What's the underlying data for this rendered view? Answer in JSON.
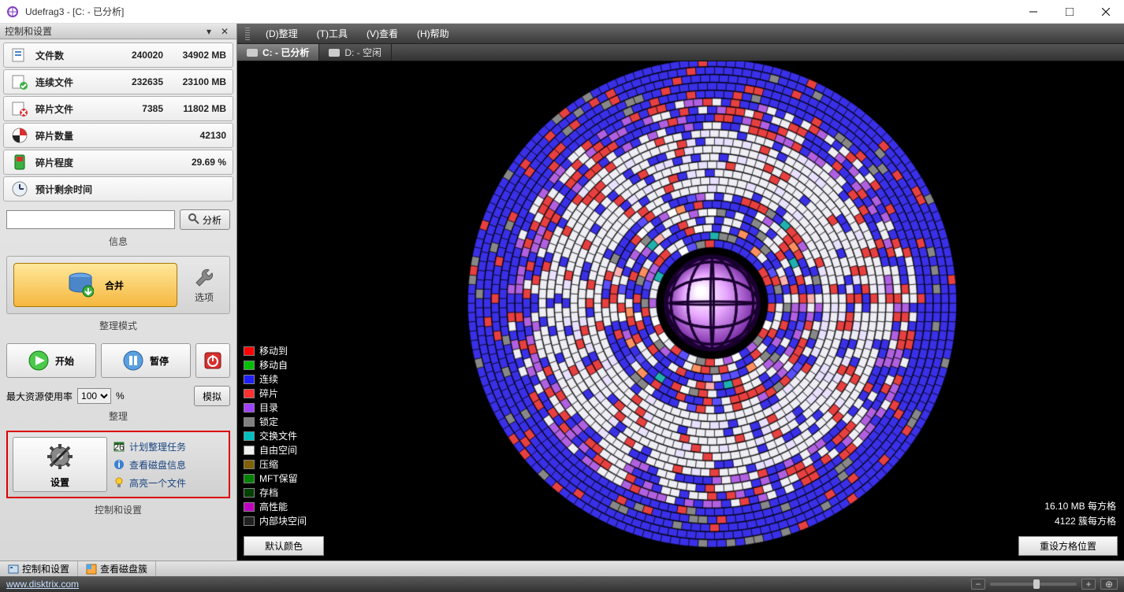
{
  "window": {
    "title": "Udefrag3 - [C: - 已分析]"
  },
  "left_panel": {
    "header": "控制和设置",
    "stats": [
      {
        "label": "文件数",
        "v1": "240020",
        "v2": "34902 MB"
      },
      {
        "label": "连续文件",
        "v1": "232635",
        "v2": "23100 MB"
      },
      {
        "label": "碎片文件",
        "v1": "7385",
        "v2": "11802 MB"
      },
      {
        "label": "碎片数量",
        "v1": "",
        "v2": "42130"
      },
      {
        "label": "碎片程度",
        "v1": "",
        "v2": "29.69 %"
      },
      {
        "label": "预计剩余时间",
        "v1": "",
        "v2": ""
      }
    ],
    "analyze_btn": "分析",
    "info_label": "信息",
    "merge_btn": "合并",
    "options_btn": "选项",
    "mode_label": "整理模式",
    "start_btn": "开始",
    "pause_btn": "暂停",
    "resource_label": "最大资源使用率",
    "resource_value": "100",
    "resource_unit": "%",
    "simulate_btn": "模拟",
    "proc_label": "整理",
    "settings_btn": "设置",
    "tasks": [
      {
        "label": "计划整理任务"
      },
      {
        "label": "查看磁盘信息"
      },
      {
        "label": "高亮一个文件"
      }
    ],
    "settings_label": "控制和设置"
  },
  "menubar": {
    "items": [
      "(D)整理",
      "(T)工具",
      "(V)查看",
      "(H)帮助"
    ]
  },
  "drive_tabs": [
    {
      "label": "C: - 已分析",
      "active": true
    },
    {
      "label": "D: - 空闲",
      "active": false
    }
  ],
  "legend": [
    {
      "color": "#ff0000",
      "label": "移动到"
    },
    {
      "color": "#00c000",
      "label": "移动自"
    },
    {
      "color": "#2020ff",
      "label": "连续"
    },
    {
      "color": "#ff3030",
      "label": "碎片"
    },
    {
      "color": "#a040ff",
      "label": "目录"
    },
    {
      "color": "#808080",
      "label": "锁定"
    },
    {
      "color": "#00c0c0",
      "label": "交换文件"
    },
    {
      "color": "#f0f0f0",
      "label": "自由空间"
    },
    {
      "color": "#806000",
      "label": "压缩"
    },
    {
      "color": "#008000",
      "label": "MFT保留"
    },
    {
      "color": "#004000",
      "label": "存档"
    },
    {
      "color": "#c000c0",
      "label": "高性能"
    },
    {
      "color": "#202020",
      "label": "内部块空间"
    }
  ],
  "viz_info": {
    "line1": "16.10 MB 每方格",
    "line2": "4122 簇每方格"
  },
  "bottom_buttons": {
    "left": "默认颜色",
    "right": "重设方格位置"
  },
  "bottom_tabs": [
    {
      "label": "控制和设置"
    },
    {
      "label": "查看磁盘簇"
    }
  ],
  "status": {
    "url": "www.disktrix.com"
  }
}
